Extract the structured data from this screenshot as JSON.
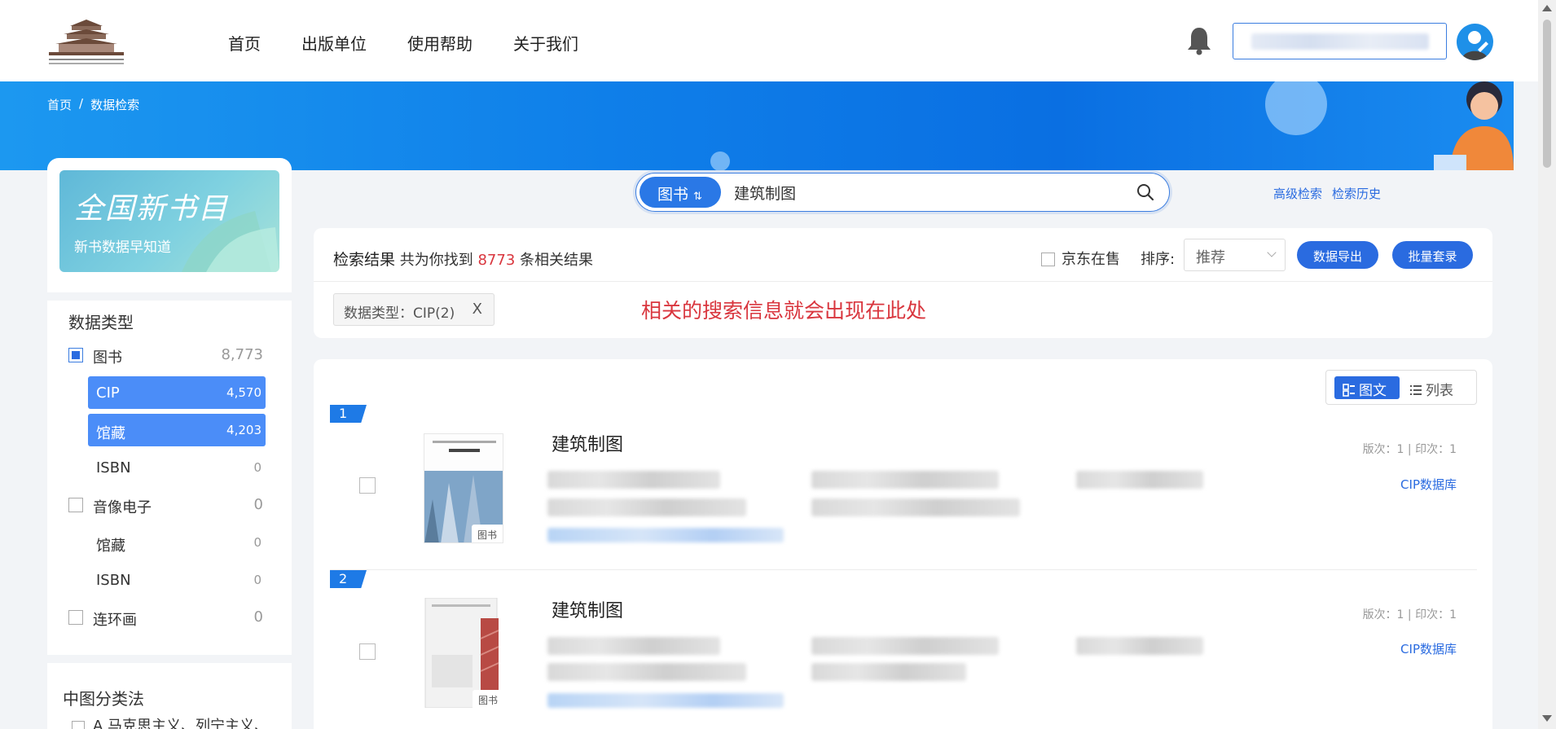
{
  "header": {
    "nav": [
      "首页",
      "出版单位",
      "使用帮助",
      "关于我们"
    ]
  },
  "breadcrumb": [
    "首页",
    "/",
    "数据检索"
  ],
  "sidebar": {
    "promo_title": "全国新书目",
    "promo_sub": "新书数据早知道",
    "data_type_title": "数据类型",
    "types": [
      {
        "label": "图书",
        "count": "8,773",
        "checked": true
      },
      {
        "label": "CIP",
        "count": "4,570",
        "active": true
      },
      {
        "label": "馆藏",
        "count": "4,203",
        "active": true
      },
      {
        "label": "ISBN",
        "count": "0"
      },
      {
        "label": "音像电子",
        "count": "0",
        "checked": false
      },
      {
        "label": "馆藏",
        "count": "0"
      },
      {
        "label": "ISBN",
        "count": "0"
      },
      {
        "label": "连环画",
        "count": "0",
        "checked": false
      }
    ],
    "class_title": "中图分类法",
    "class_first": "A 马克思主义、列宁主义、"
  },
  "search": {
    "type_label": "图书",
    "type_arrow": "⇅",
    "query": "建筑制图",
    "advanced": "高级检索",
    "history": "检索历史"
  },
  "results": {
    "label": "检索结果",
    "found_prefix": "共为你找到",
    "count": "8773",
    "found_suffix": "条相关结果",
    "jd_label": "京东在售",
    "sort_label": "排序:",
    "sort_value": "推荐",
    "export_btn": "数据导出",
    "batch_btn": "批量套录",
    "filter_tag": "数据类型：CIP(2)",
    "filter_close": "X",
    "hint": "相关的搜索信息就会出现在此处"
  },
  "view": {
    "grid_label": "图文",
    "list_label": "列表"
  },
  "items": [
    {
      "rank": "1",
      "title": "建筑制图",
      "meta": "版次：1  |  印次：1",
      "db": "CIP数据库",
      "tag": "图书"
    },
    {
      "rank": "2",
      "title": "建筑制图",
      "meta": "版次：1  |  印次：1",
      "db": "CIP数据库",
      "tag": "图书"
    }
  ],
  "colors": {
    "accent": "#2a6be0",
    "red": "#d9363e",
    "banner": "#0f7fe9"
  }
}
